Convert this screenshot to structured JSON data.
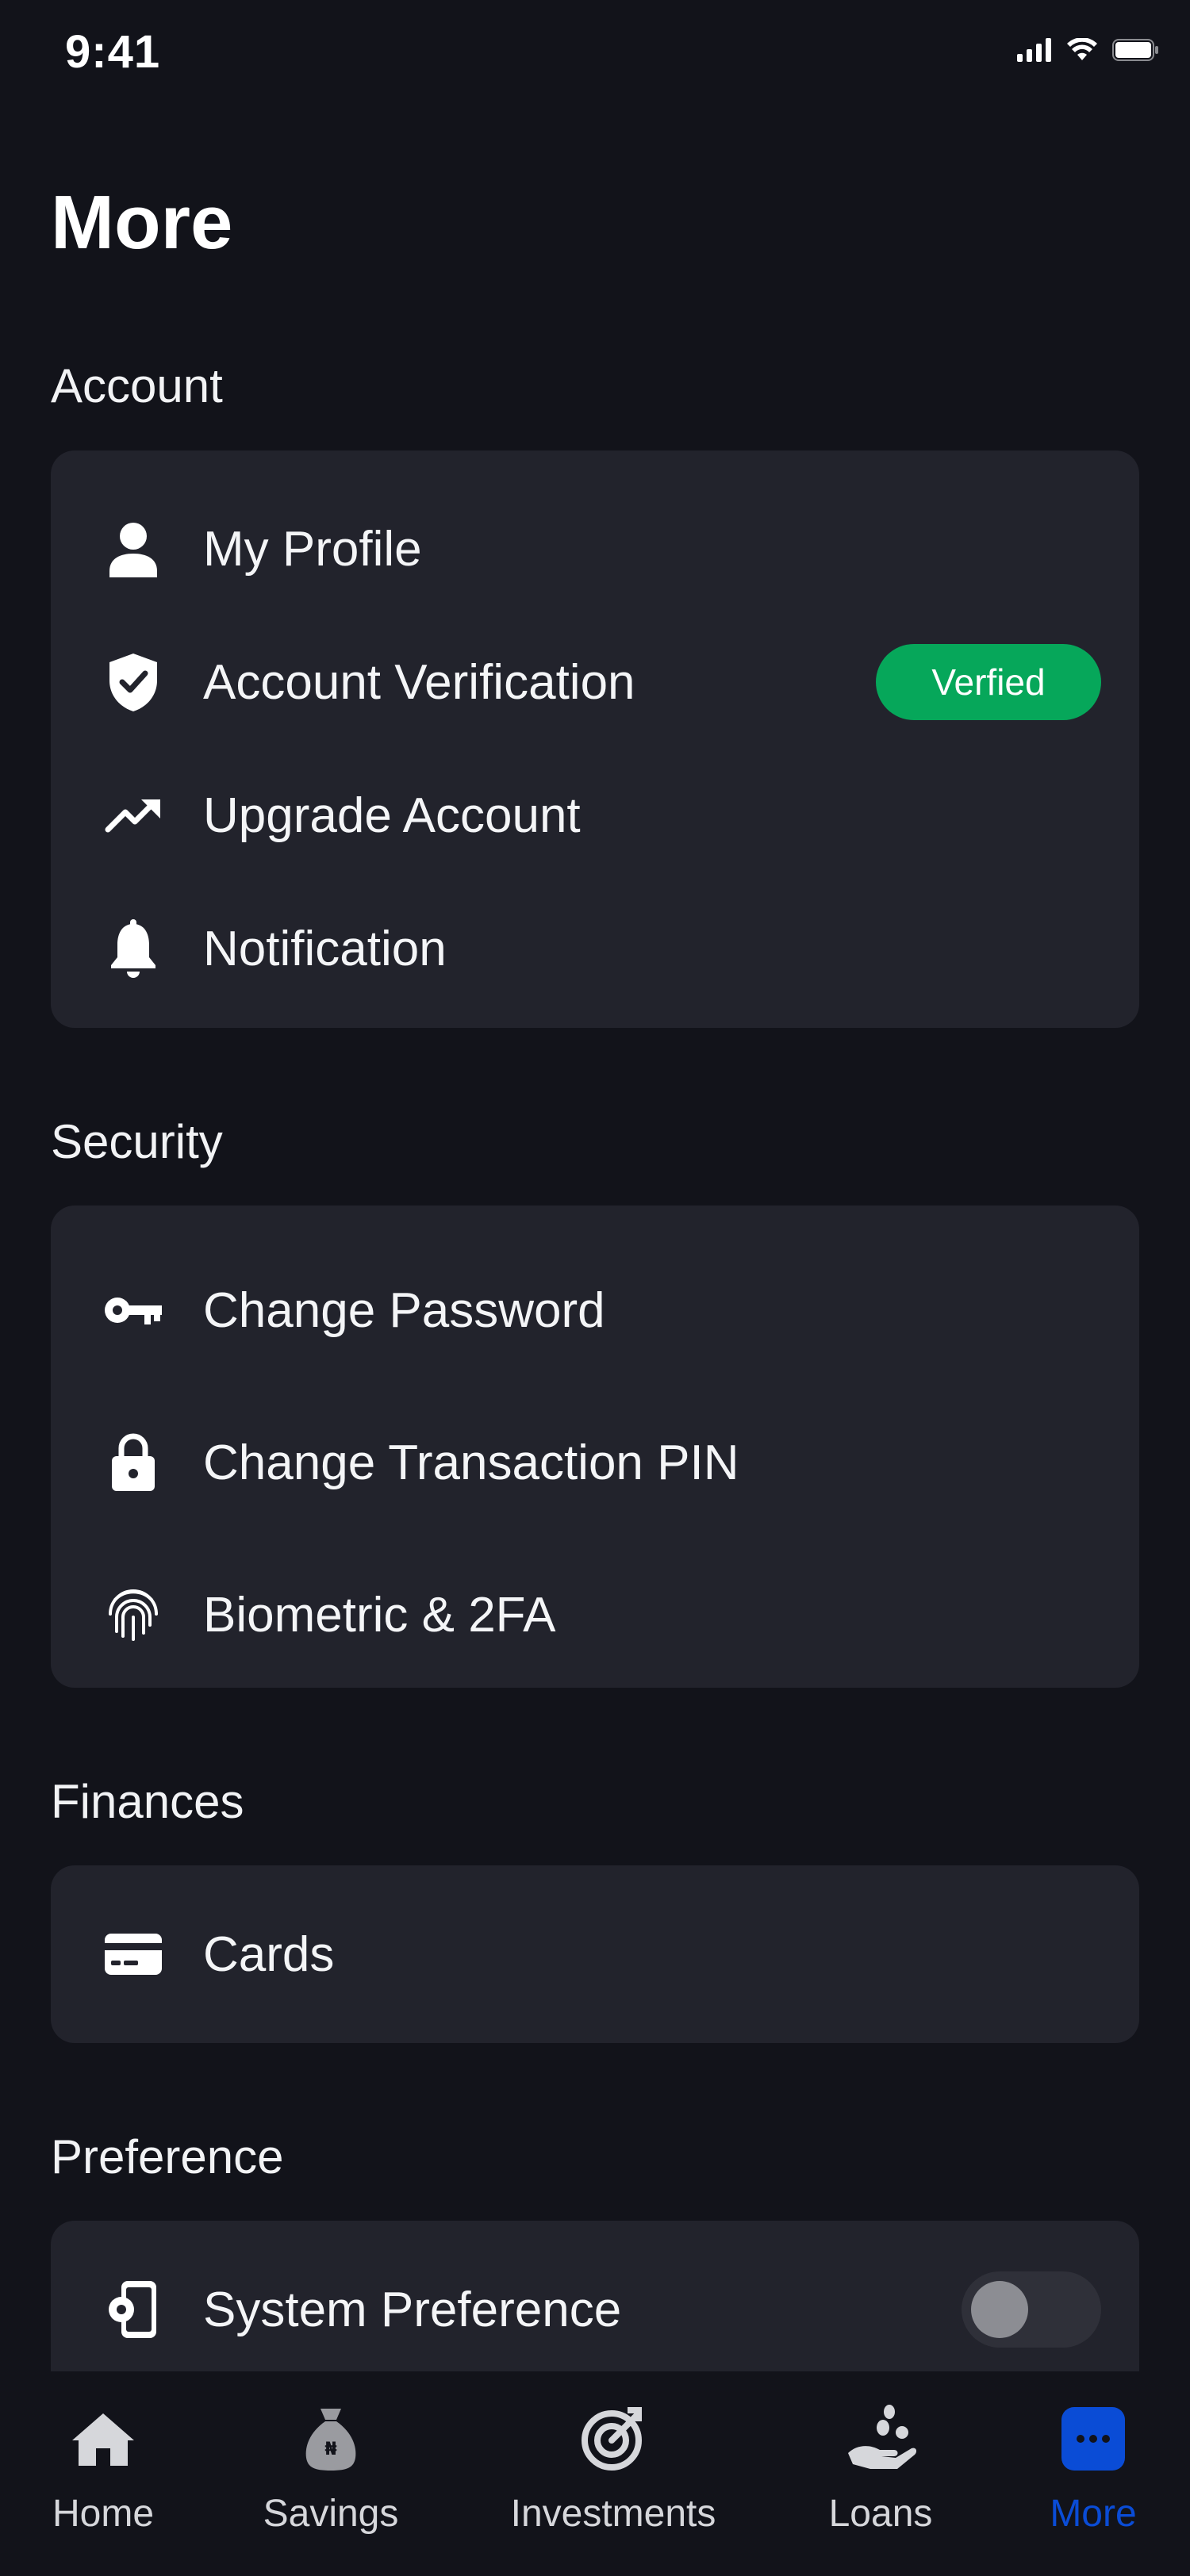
{
  "status": {
    "time": "9:41",
    "icons": [
      "signal-icon",
      "wifi-icon",
      "battery-icon"
    ]
  },
  "page": {
    "title": "More"
  },
  "sections": {
    "account": {
      "label": "Account",
      "items": [
        {
          "label": "My Profile",
          "icon": "person-icon"
        },
        {
          "label": "Account Verification",
          "icon": "shield-check-icon",
          "badge": "Verfied"
        },
        {
          "label": "Upgrade Account",
          "icon": "trending-up-icon"
        },
        {
          "label": "Notification",
          "icon": "bell-icon"
        }
      ]
    },
    "security": {
      "label": "Security",
      "items": [
        {
          "label": "Change Password",
          "icon": "key-icon"
        },
        {
          "label": "Change Transaction PIN",
          "icon": "lock-icon"
        },
        {
          "label": "Biometric & 2FA",
          "icon": "fingerprint-icon"
        }
      ]
    },
    "finances": {
      "label": "Finances",
      "items": [
        {
          "label": "Cards",
          "icon": "card-icon"
        }
      ]
    },
    "preference": {
      "label": "Preference",
      "items": [
        {
          "label": "System Preference",
          "icon": "phone-settings-icon",
          "toggle_on": false
        }
      ]
    }
  },
  "tabs": [
    {
      "label": "Home",
      "icon": "home-icon",
      "active": false
    },
    {
      "label": "Savings",
      "icon": "money-bag-icon",
      "active": false
    },
    {
      "label": "Investments",
      "icon": "target-icon",
      "active": false
    },
    {
      "label": "Loans",
      "icon": "hand-coin-icon",
      "active": false
    },
    {
      "label": "More",
      "icon": "more-icon",
      "active": true
    }
  ],
  "colors": {
    "background": "#12131a",
    "card": "#22232c",
    "verified_badge": "#06a75a",
    "active_tab": "#0a4cd6"
  }
}
